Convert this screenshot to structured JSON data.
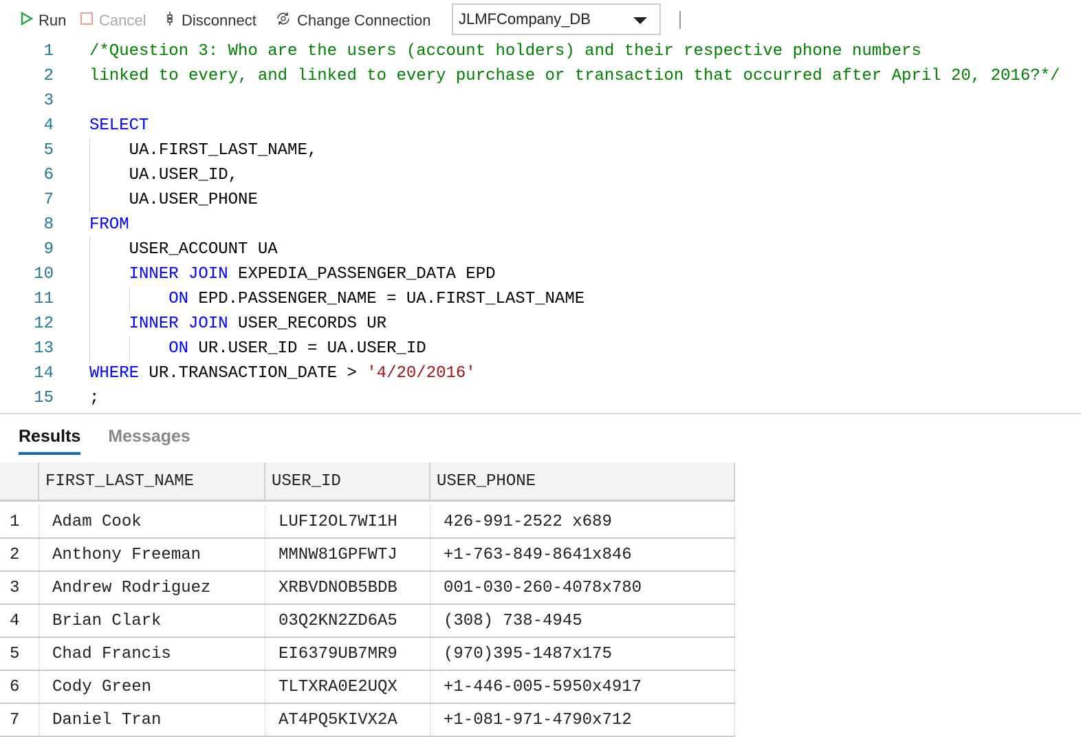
{
  "toolbar": {
    "run": "Run",
    "cancel": "Cancel",
    "disconnect": "Disconnect",
    "change_connection": "Change Connection",
    "database": "JLMFCompany_DB"
  },
  "editor": {
    "lines": [
      {
        "n": "1",
        "parts": [
          {
            "t": "/*Question 3: Who are the users (account holders) and their respective phone numbers",
            "c": "cm"
          }
        ]
      },
      {
        "n": "2",
        "parts": [
          {
            "t": "linked to every, and linked to every purchase or transaction that occurred after April 20, 2016?*/",
            "c": "cm"
          }
        ]
      },
      {
        "n": "3",
        "parts": []
      },
      {
        "n": "4",
        "parts": [
          {
            "t": "SELECT",
            "c": "kw"
          }
        ]
      },
      {
        "n": "5",
        "parts": [
          {
            "t": "    UA.FIRST_LAST_NAME,",
            "c": ""
          }
        ]
      },
      {
        "n": "6",
        "parts": [
          {
            "t": "    UA.USER_ID,",
            "c": ""
          }
        ]
      },
      {
        "n": "7",
        "parts": [
          {
            "t": "    UA.USER_PHONE",
            "c": ""
          }
        ]
      },
      {
        "n": "8",
        "parts": [
          {
            "t": "FROM",
            "c": "kw"
          }
        ]
      },
      {
        "n": "9",
        "parts": [
          {
            "t": "    USER_ACCOUNT UA",
            "c": ""
          }
        ]
      },
      {
        "n": "10",
        "parts": [
          {
            "t": "    ",
            "c": ""
          },
          {
            "t": "INNER JOIN",
            "c": "kw"
          },
          {
            "t": " EXPEDIA_PASSENGER_DATA EPD",
            "c": ""
          }
        ]
      },
      {
        "n": "11",
        "parts": [
          {
            "t": "        ",
            "c": ""
          },
          {
            "t": "ON",
            "c": "kw"
          },
          {
            "t": " EPD.PASSENGER_NAME = UA.FIRST_LAST_NAME",
            "c": ""
          }
        ]
      },
      {
        "n": "12",
        "parts": [
          {
            "t": "    ",
            "c": ""
          },
          {
            "t": "INNER JOIN",
            "c": "kw"
          },
          {
            "t": " USER_RECORDS UR",
            "c": ""
          }
        ]
      },
      {
        "n": "13",
        "parts": [
          {
            "t": "        ",
            "c": ""
          },
          {
            "t": "ON",
            "c": "kw"
          },
          {
            "t": " UR.USER_ID = UA.USER_ID",
            "c": ""
          }
        ]
      },
      {
        "n": "14",
        "parts": [
          {
            "t": "WHERE",
            "c": "kw"
          },
          {
            "t": " UR.TRANSACTION_DATE > ",
            "c": ""
          },
          {
            "t": "'4/20/2016'",
            "c": "str"
          }
        ]
      },
      {
        "n": "15",
        "parts": [
          {
            "t": ";",
            "c": ""
          }
        ]
      }
    ]
  },
  "results": {
    "tabs": [
      "Results",
      "Messages"
    ],
    "columns": [
      "FIRST_LAST_NAME",
      "USER_ID",
      "USER_PHONE"
    ],
    "rows": [
      [
        "1",
        "Adam Cook",
        "LUFI2OL7WI1H",
        "426-991-2522 x689"
      ],
      [
        "2",
        "Anthony Freeman",
        "MMNW81GPFWTJ",
        "+1-763-849-8641x846"
      ],
      [
        "3",
        "Andrew Rodriguez",
        "XRBVDNOB5BDB",
        "001-030-260-4078x780"
      ],
      [
        "4",
        "Brian Clark",
        "03Q2KN2ZD6A5",
        "(308) 738-4945"
      ],
      [
        "5",
        "Chad Francis",
        "EI6379UB7MR9",
        "(970)395-1487x175"
      ],
      [
        "6",
        "Cody Green",
        "TLTXRA0E2UQX",
        "+1-446-005-5950x4917"
      ],
      [
        "7",
        "Daniel Tran",
        "AT4PQ5KIVX2A",
        "+1-081-971-4790x712"
      ]
    ]
  }
}
